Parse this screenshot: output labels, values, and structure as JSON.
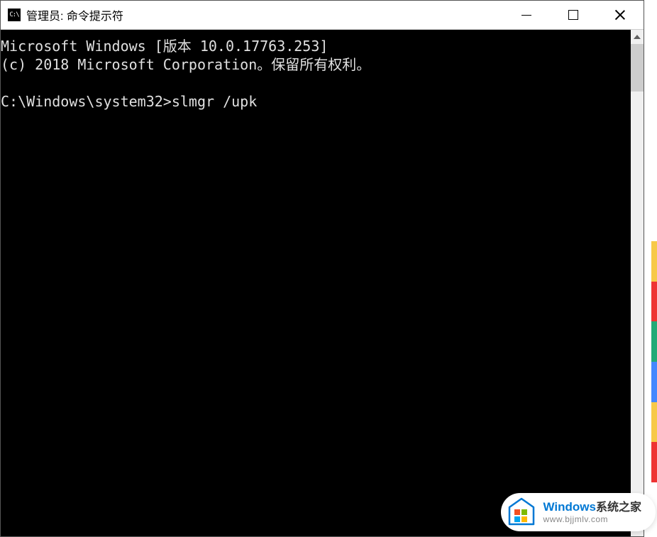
{
  "window": {
    "title": "管理员: 命令提示符",
    "icon_label": "C:\\"
  },
  "terminal": {
    "line1": "Microsoft Windows [版本 10.0.17763.253]",
    "line2": "(c) 2018 Microsoft Corporation。保留所有权利。",
    "prompt": "C:\\Windows\\system32>",
    "command": "slmgr /upk"
  },
  "watermark": {
    "brand_en": "Windows",
    "brand_cn": "系统之家",
    "url": "www.bjjmlv.com"
  }
}
